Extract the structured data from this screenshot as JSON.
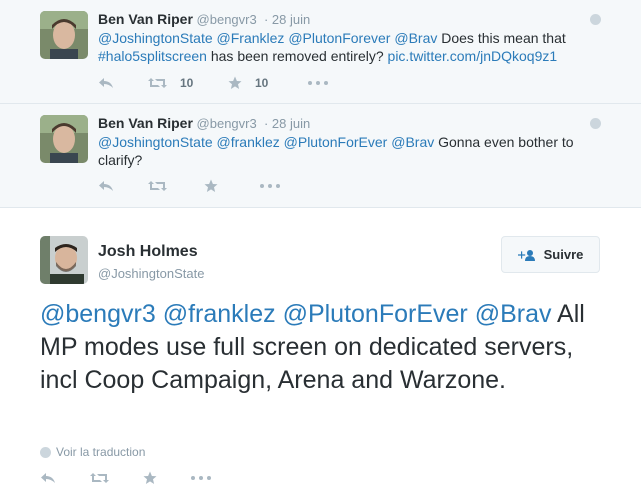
{
  "tweet1": {
    "name": "Ben Van Riper",
    "handle": "@bengvr3",
    "time": "28 juin",
    "text_parts": [
      "@JoshingtonState",
      "@Franklez",
      "@PlutonForever",
      "@Brav",
      " Does this mean that ",
      "#halo5splitscreen",
      " has been removed entirely? ",
      "pic.twitter.com/jnDQkoq9z1"
    ],
    "retweet_count": "10",
    "favorite_count": "10"
  },
  "tweet2": {
    "name": "Ben Van Riper",
    "handle": "@bengvr3",
    "time": "28 juin",
    "text_parts": [
      "@JoshingtonState",
      "@franklez",
      "@PlutonForEver",
      "@Brav",
      " Gonna even bother to clarify?"
    ]
  },
  "main_tweet": {
    "name": "Josh Holmes",
    "handle": "@JoshingtonState",
    "follow_label": "Suivre",
    "text_parts": [
      "@bengvr3",
      "@franklez",
      "@PlutonForEver",
      "@Brav",
      " All MP modes use full screen on dedicated servers, incl Coop Campaign, Arena and Warzone."
    ],
    "translate_label": "Voir la traduction"
  },
  "icons": [
    "reply-icon",
    "retweet-icon",
    "favorite-icon",
    "more-icon",
    "globe-icon",
    "follow-user-icon"
  ],
  "colors": {
    "link": "#2b7bb9",
    "muted": "#8899a6",
    "text": "#292f33",
    "bg_context": "#f5f8fa"
  }
}
